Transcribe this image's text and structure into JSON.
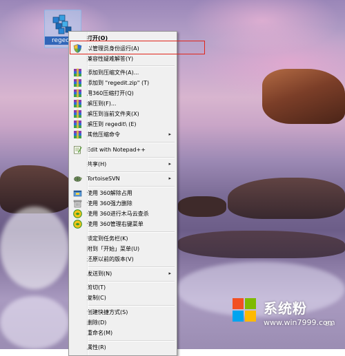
{
  "desktop": {
    "icon_label": "regedit"
  },
  "context_menu": {
    "items": [
      {
        "label": "打开(O)",
        "bold": true,
        "icon": "none"
      },
      {
        "label": "以管理员身份运行(A)",
        "icon": "uac-shield-icon"
      },
      {
        "label": "兼容性疑难解答(Y)",
        "icon": "none"
      },
      {
        "label": "添加到压缩文件(A)...",
        "icon": "winrar-icon"
      },
      {
        "label": "添加到 \"regedit.zip\" (T)",
        "icon": "winrar-icon"
      },
      {
        "label": "用360压缩打开(Q)",
        "icon": "winrar-icon"
      },
      {
        "label": "解压到(F)...",
        "icon": "winrar-icon"
      },
      {
        "label": "解压到当前文件夹(X)",
        "icon": "winrar-icon"
      },
      {
        "label": "解压到 regedit\\ (E)",
        "icon": "winrar-icon"
      },
      {
        "label": "其他压缩命令",
        "icon": "winrar-icon",
        "submenu": true
      },
      {
        "label": "Edit with Notepad++",
        "icon": "notepadpp-icon"
      },
      {
        "label": "共享(H)",
        "icon": "none",
        "submenu": true
      },
      {
        "label": "TortoiseSVN",
        "icon": "tortoisesvn-icon",
        "submenu": true
      },
      {
        "label": "使用 360解除占用",
        "icon": "360-unlock-icon"
      },
      {
        "label": "使用 360强力删除",
        "icon": "360-delete-icon"
      },
      {
        "label": "使用 360进行木马云查杀",
        "icon": "360-scan-icon"
      },
      {
        "label": "使用 360管理右键菜单",
        "icon": "360-manage-icon"
      },
      {
        "label": "锁定到任务栏(K)",
        "icon": "none"
      },
      {
        "label": "附到「开始」菜单(U)",
        "icon": "none"
      },
      {
        "label": "还原以前的版本(V)",
        "icon": "none"
      },
      {
        "label": "发送到(N)",
        "icon": "none",
        "submenu": true
      },
      {
        "label": "剪切(T)",
        "icon": "none"
      },
      {
        "label": "复制(C)",
        "icon": "none"
      },
      {
        "label": "创建快捷方式(S)",
        "icon": "none"
      },
      {
        "label": "删除(D)",
        "icon": "none"
      },
      {
        "label": "重命名(M)",
        "icon": "none"
      },
      {
        "label": "属性(R)",
        "icon": "none"
      }
    ],
    "submenu_arrow": "▸",
    "highlight_color": "#e0241a"
  },
  "watermark": {
    "title": "系统粉",
    "url": "www.win7999.com",
    "tag": "Ba"
  },
  "colors": {
    "menu_bg": "#f0f0f0",
    "menu_border": "#979797",
    "icon_selection": "#3166b8"
  }
}
